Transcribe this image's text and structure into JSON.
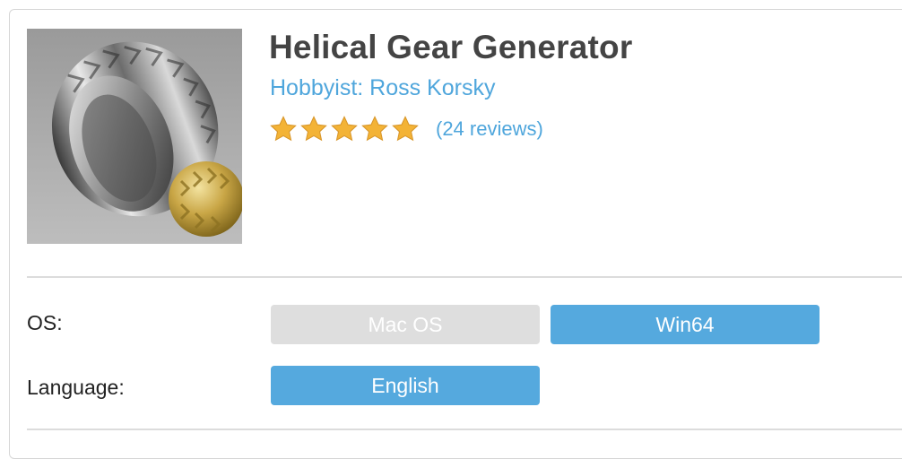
{
  "product": {
    "title": "Helical Gear Generator",
    "author": "Hobbyist: Ross Korsky",
    "rating": 5,
    "rating_max": 5,
    "reviews_text": "(24 reviews)",
    "thumbnail_icon": "helical-gear-render"
  },
  "options": {
    "os": {
      "label": "OS:",
      "choices": [
        {
          "label": "Mac OS",
          "state": "disabled"
        },
        {
          "label": "Win64",
          "state": "selected"
        }
      ]
    },
    "language": {
      "label": "Language:",
      "choices": [
        {
          "label": "English",
          "state": "selected"
        }
      ]
    }
  },
  "colors": {
    "accent": "#55a9de",
    "link": "#4fa6dc",
    "disabled": "#dedede",
    "star": "#f3b336",
    "title": "#444444"
  }
}
